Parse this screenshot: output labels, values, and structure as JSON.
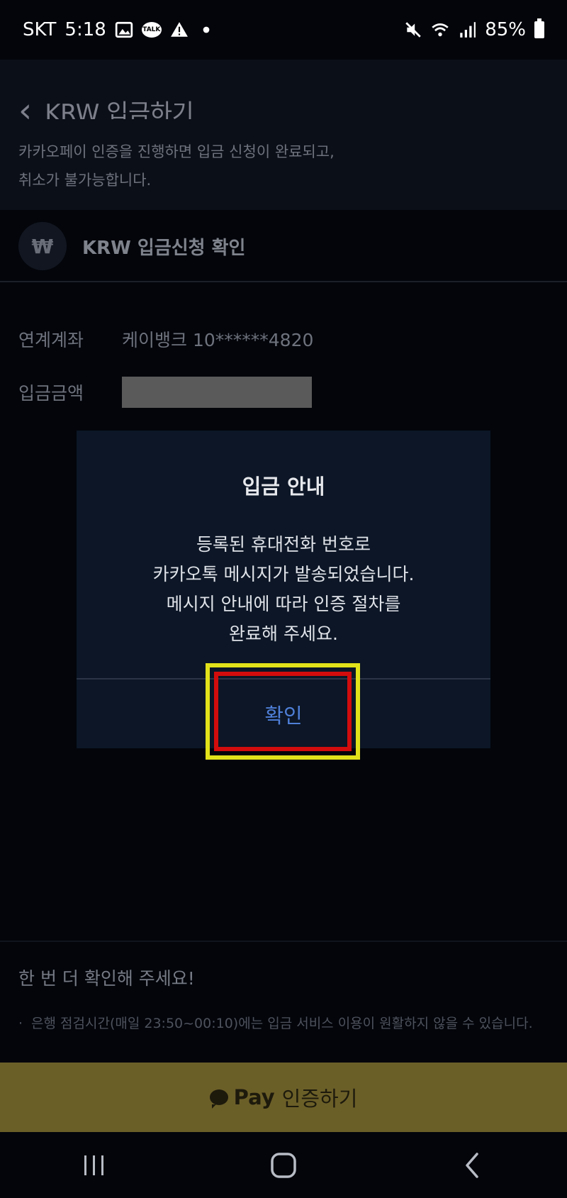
{
  "status_bar": {
    "carrier": "SKT",
    "time": "5:18",
    "talk_badge": "TALK",
    "battery": "85%"
  },
  "header": {
    "title": "KRW 입금하기"
  },
  "notice": {
    "line1": "카카오페이 인증을 진행하면 입금 신청이 완료되고,",
    "line2": "취소가 불가능합니다."
  },
  "section": {
    "currency_symbol": "₩",
    "title": "KRW 입금신청 확인"
  },
  "details": {
    "account_label": "연계계좌",
    "account_value": "케이뱅크 10******4820",
    "amount_label": "입금금액"
  },
  "dialog": {
    "title": "입금 안내",
    "body": [
      "등록된 휴대전화 번호로",
      "카카오톡 메시지가 발송되었습니다.",
      "메시지 안내에 따라 인증 절차를",
      "완료해 주세요."
    ],
    "ok_label": "확인"
  },
  "footer": {
    "reminder": "한 번 더 확인해 주세요!",
    "bullet": "·",
    "footnote": "은행 점검시간(매일 23:50~00:10)에는 입금 서비스 이용이 원활하지 않을 수 있습니다."
  },
  "pay_button": {
    "brand": "Pay",
    "label": "인증하기"
  },
  "colors": {
    "background": "#03050b",
    "dialog": "#0c1626",
    "ok_text": "#4f7fd8",
    "pay_bar": "#6b5f28",
    "highlight_outer": "#e2e21a",
    "highlight_inner": "#d20c0c"
  }
}
